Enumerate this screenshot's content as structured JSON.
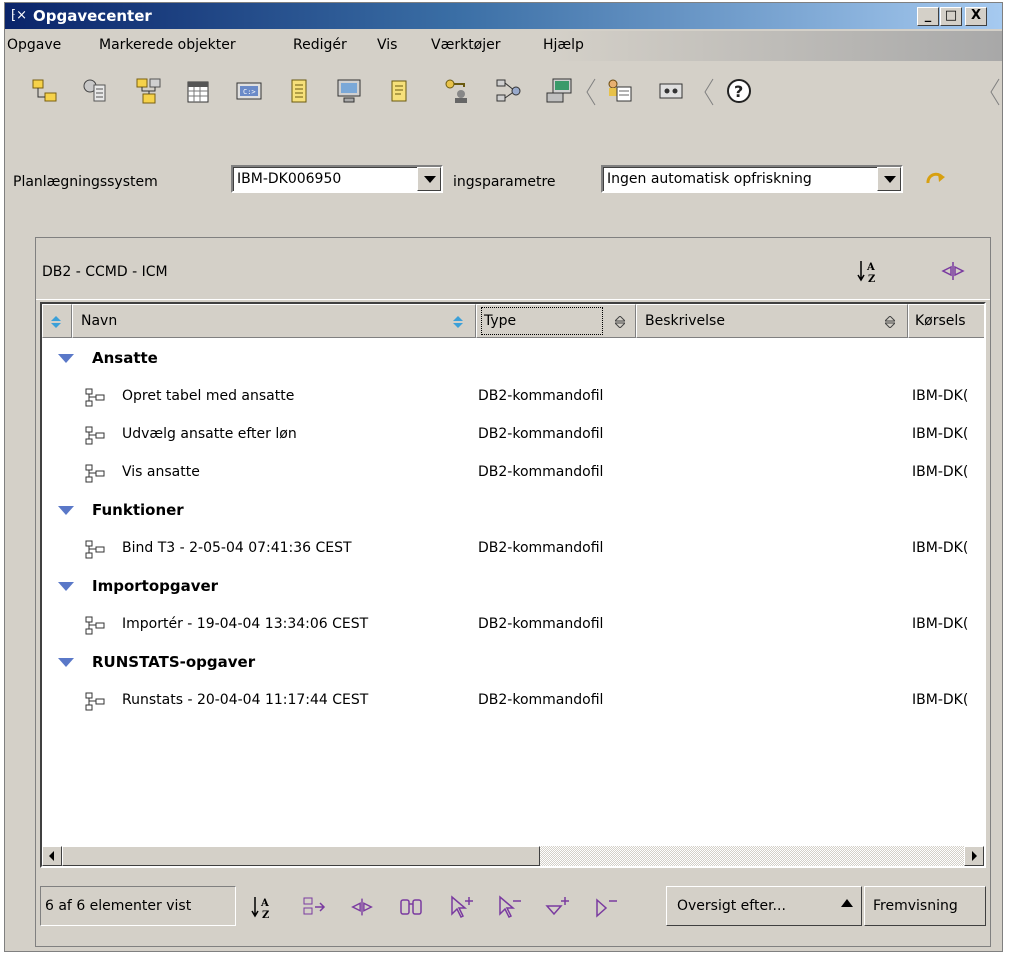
{
  "window": {
    "title": "Opgavecenter",
    "controls": {
      "minimize": "_",
      "maximize": "□",
      "close": "X"
    }
  },
  "menubar": {
    "items": [
      {
        "label": "Opgave"
      },
      {
        "label": "Markerede objekter"
      },
      {
        "label": "Redigér"
      },
      {
        "label": "Vis"
      },
      {
        "label": "Værktøjer"
      },
      {
        "label": "Hjælp"
      }
    ]
  },
  "toolbar": {
    "icons": [
      "folder-tree-icon",
      "task-gear-icon",
      "task-network-icon",
      "calendar-icon",
      "command-window-icon",
      "list-icon",
      "monitor-icon",
      "notepad-icon",
      "key-user-icon",
      "network-tools-icon",
      "computer-icon",
      "contact-icon",
      "keyboard-icon",
      "help-icon"
    ]
  },
  "scheduler": {
    "label": "Planlægningssystem",
    "system_value": "IBM-DK006950",
    "refresh_label": "ingsparametre",
    "refresh_value": "Ingen automatisk opfriskning"
  },
  "panel": {
    "title": "DB2 - CCMD - ICM",
    "columns": [
      {
        "label": "Navn"
      },
      {
        "label": "Type"
      },
      {
        "label": "Beskrivelse"
      },
      {
        "label": "Kørsels"
      }
    ],
    "groups": [
      {
        "name": "Ansatte",
        "rows": [
          {
            "name": "Opret tabel med ansatte",
            "type": "DB2-kommandofil",
            "run": "IBM-DK("
          },
          {
            "name": "Udvælg ansatte efter løn",
            "type": "DB2-kommandofil",
            "run": "IBM-DK("
          },
          {
            "name": "Vis ansatte",
            "type": "DB2-kommandofil",
            "run": "IBM-DK("
          }
        ]
      },
      {
        "name": "Funktioner",
        "rows": [
          {
            "name": "Bind T3 - 2-05-04 07:41:36 CEST",
            "type": "DB2-kommandofil",
            "run": "IBM-DK("
          }
        ]
      },
      {
        "name": "Importopgaver",
        "rows": [
          {
            "name": "Importér - 19-04-04 13:34:06 CEST",
            "type": "DB2-kommandofil",
            "run": "IBM-DK("
          }
        ]
      },
      {
        "name": "RUNSTATS-opgaver",
        "rows": [
          {
            "name": "Runstats - 20-04-04 11:17:44 CEST",
            "type": "DB2-kommandofil",
            "run": "IBM-DK("
          }
        ]
      }
    ]
  },
  "statusbar": {
    "count_text": "6 af 6 elementer vist",
    "overview_label": "Oversigt efter...",
    "view_label": "Fremvisning"
  },
  "colors": {
    "title_start": "#0a246a",
    "title_end": "#a6caf0",
    "group_triangle": "#5a78c8",
    "sorter": "#3ca0d8"
  }
}
